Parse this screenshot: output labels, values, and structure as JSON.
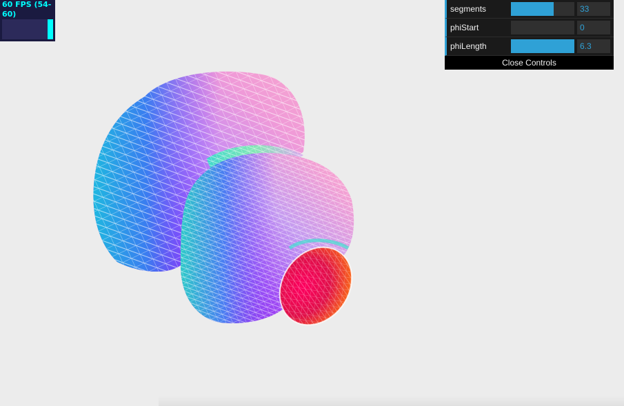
{
  "stats": {
    "fps_text": "60 FPS (54-60)",
    "fps_value": 60,
    "fps_min": 54,
    "fps_max": 60
  },
  "controls": {
    "rows": [
      {
        "label": "segments",
        "value": "33",
        "fraction": 0.67
      },
      {
        "label": "phiStart",
        "value": "0",
        "fraction": 0.0
      },
      {
        "label": "phiLength",
        "value": "6.3",
        "fraction": 1.0
      }
    ],
    "close_label": "Close Controls"
  },
  "colors": {
    "background": "#ececec",
    "accent": "#2fa1d6",
    "fps_text": "#00ffff",
    "stats_bg": "#1a1a40"
  }
}
